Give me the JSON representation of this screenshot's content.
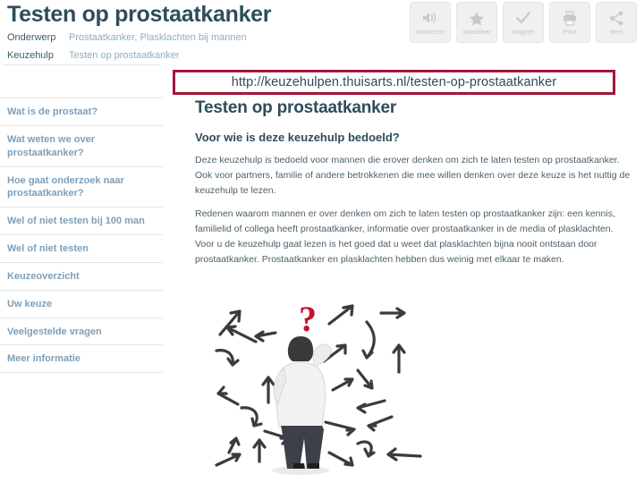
{
  "header": {
    "title": "Testen op prostaatkanker",
    "meta": [
      {
        "label": "Onderwerp",
        "value": "Prostaatkanker, Plasklachten bij mannen"
      },
      {
        "label": "Keuzehulp",
        "value": "Testen op prostaatkanker"
      }
    ]
  },
  "toolbar": {
    "buttons": [
      {
        "label": "voorlezen",
        "icon": "speaker-icon"
      },
      {
        "label": "waardeer",
        "icon": "star-icon"
      },
      {
        "label": "reageer",
        "icon": "check-icon"
      },
      {
        "label": "Print",
        "icon": "printer-icon"
      },
      {
        "label": "deel",
        "icon": "share-icon"
      }
    ]
  },
  "sidebar": {
    "items": [
      {
        "label": "Wat is de prostaat?"
      },
      {
        "label": "Wat weten we over prostaatkanker?"
      },
      {
        "label": "Hoe gaat onderzoek naar prostaatkanker?"
      },
      {
        "label": "Wel of niet testen bij 100 man"
      },
      {
        "label": "Wel of niet testen"
      },
      {
        "label": "Keuzeoverzicht"
      },
      {
        "label": "Uw keuze"
      },
      {
        "label": "Veelgestelde vragen"
      },
      {
        "label": "Meer informatie"
      }
    ]
  },
  "content": {
    "title": "Testen op prostaatkanker",
    "subtitle": "Voor wie is deze keuzehulp bedoeld?",
    "paragraphs": [
      "Deze keuzehulp is bedoeld voor mannen die erover denken om zich te laten testen op prostaatkanker. Ook voor partners, familie of andere betrokkenen die mee willen denken over deze keuze is het nuttig de keuzehulp te lezen.",
      "Redenen waarom mannen er over denken om zich te laten testen op prostaatkanker zijn: een kennis, familielid of collega heeft prostaatkanker, informatie over prostaatkanker in de media of plasklachten.",
      "Voor u de keuzehulp gaat lezen is het goed dat u weet dat plasklachten bijna nooit ontstaan door prostaatkanker. Prostaatkanker en plasklachten hebben dus weinig met elkaar te maken."
    ]
  },
  "url_overlay": {
    "url": "http://keuzehulpen.thuisarts.nl/testen-op-prostaatkanker",
    "border_color": "#a3163a"
  },
  "illustration": {
    "alt": "man-with-question-mark-and-arrows",
    "question_mark": "?",
    "question_mark_color": "#c41230",
    "arrow_color": "#3b3b3b"
  },
  "colors": {
    "title": "#2d4d5c",
    "sidebar_link": "#7e9fb9",
    "meta_value": "#8fadc2",
    "body_text": "#4b5f6b",
    "toolbar_bg": "#f0f0f0"
  }
}
